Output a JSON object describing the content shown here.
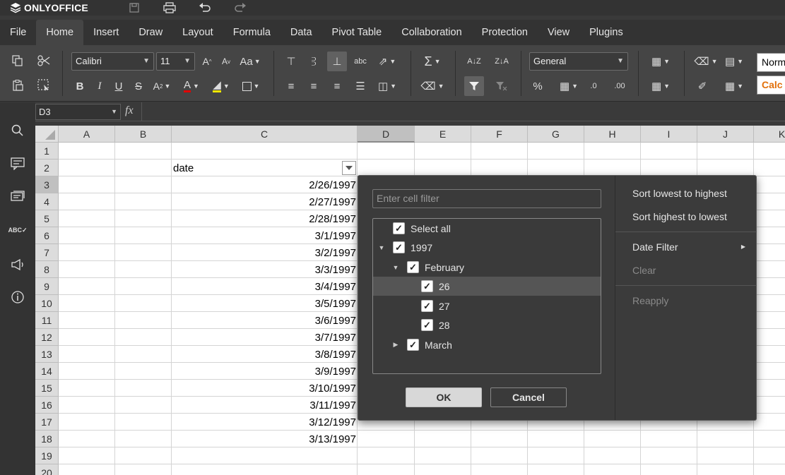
{
  "app": {
    "brand": "ONLYOFFICE"
  },
  "menu": [
    "File",
    "Home",
    "Insert",
    "Draw",
    "Layout",
    "Formula",
    "Data",
    "Pivot Table",
    "Collaboration",
    "Protection",
    "View",
    "Plugins"
  ],
  "toolbar": {
    "font_name": "Calibri",
    "font_size": "11",
    "number_format": "General",
    "style_normal": "Norm",
    "style_calc": "Calc"
  },
  "formula_bar": {
    "cell_ref": "D3",
    "fx": "fx",
    "value": ""
  },
  "grid": {
    "columns": [
      "A",
      "B",
      "C",
      "D",
      "E",
      "F",
      "G",
      "H",
      "I",
      "J",
      "K"
    ],
    "rows": [
      "1",
      "2",
      "3",
      "4",
      "5",
      "6",
      "7",
      "8",
      "9",
      "10",
      "11",
      "12",
      "13",
      "14",
      "15",
      "16",
      "17",
      "18",
      "19",
      "20"
    ],
    "header_cell": "date",
    "dates": [
      "2/26/1997",
      "2/27/1997",
      "2/28/1997",
      "3/1/1997",
      "3/2/1997",
      "3/3/1997",
      "3/4/1997",
      "3/5/1997",
      "3/6/1997",
      "3/7/1997",
      "3/8/1997",
      "3/9/1997",
      "3/10/1997",
      "3/11/1997",
      "3/12/1997",
      "3/13/1997"
    ]
  },
  "autofilter": {
    "search_placeholder": "Enter cell filter",
    "items": [
      {
        "label": "Select all",
        "checked": true
      },
      {
        "label": "1997",
        "checked": true
      },
      {
        "label": "February",
        "checked": true
      },
      {
        "label": "26",
        "checked": true
      },
      {
        "label": "27",
        "checked": true
      },
      {
        "label": "28",
        "checked": true
      },
      {
        "label": "March",
        "checked": true
      }
    ],
    "ok_label": "OK",
    "cancel_label": "Cancel",
    "sort_asc": "Sort lowest to highest",
    "sort_desc": "Sort highest to lowest",
    "date_filter": "Date Filter",
    "clear": "Clear",
    "reapply": "Reapply"
  }
}
